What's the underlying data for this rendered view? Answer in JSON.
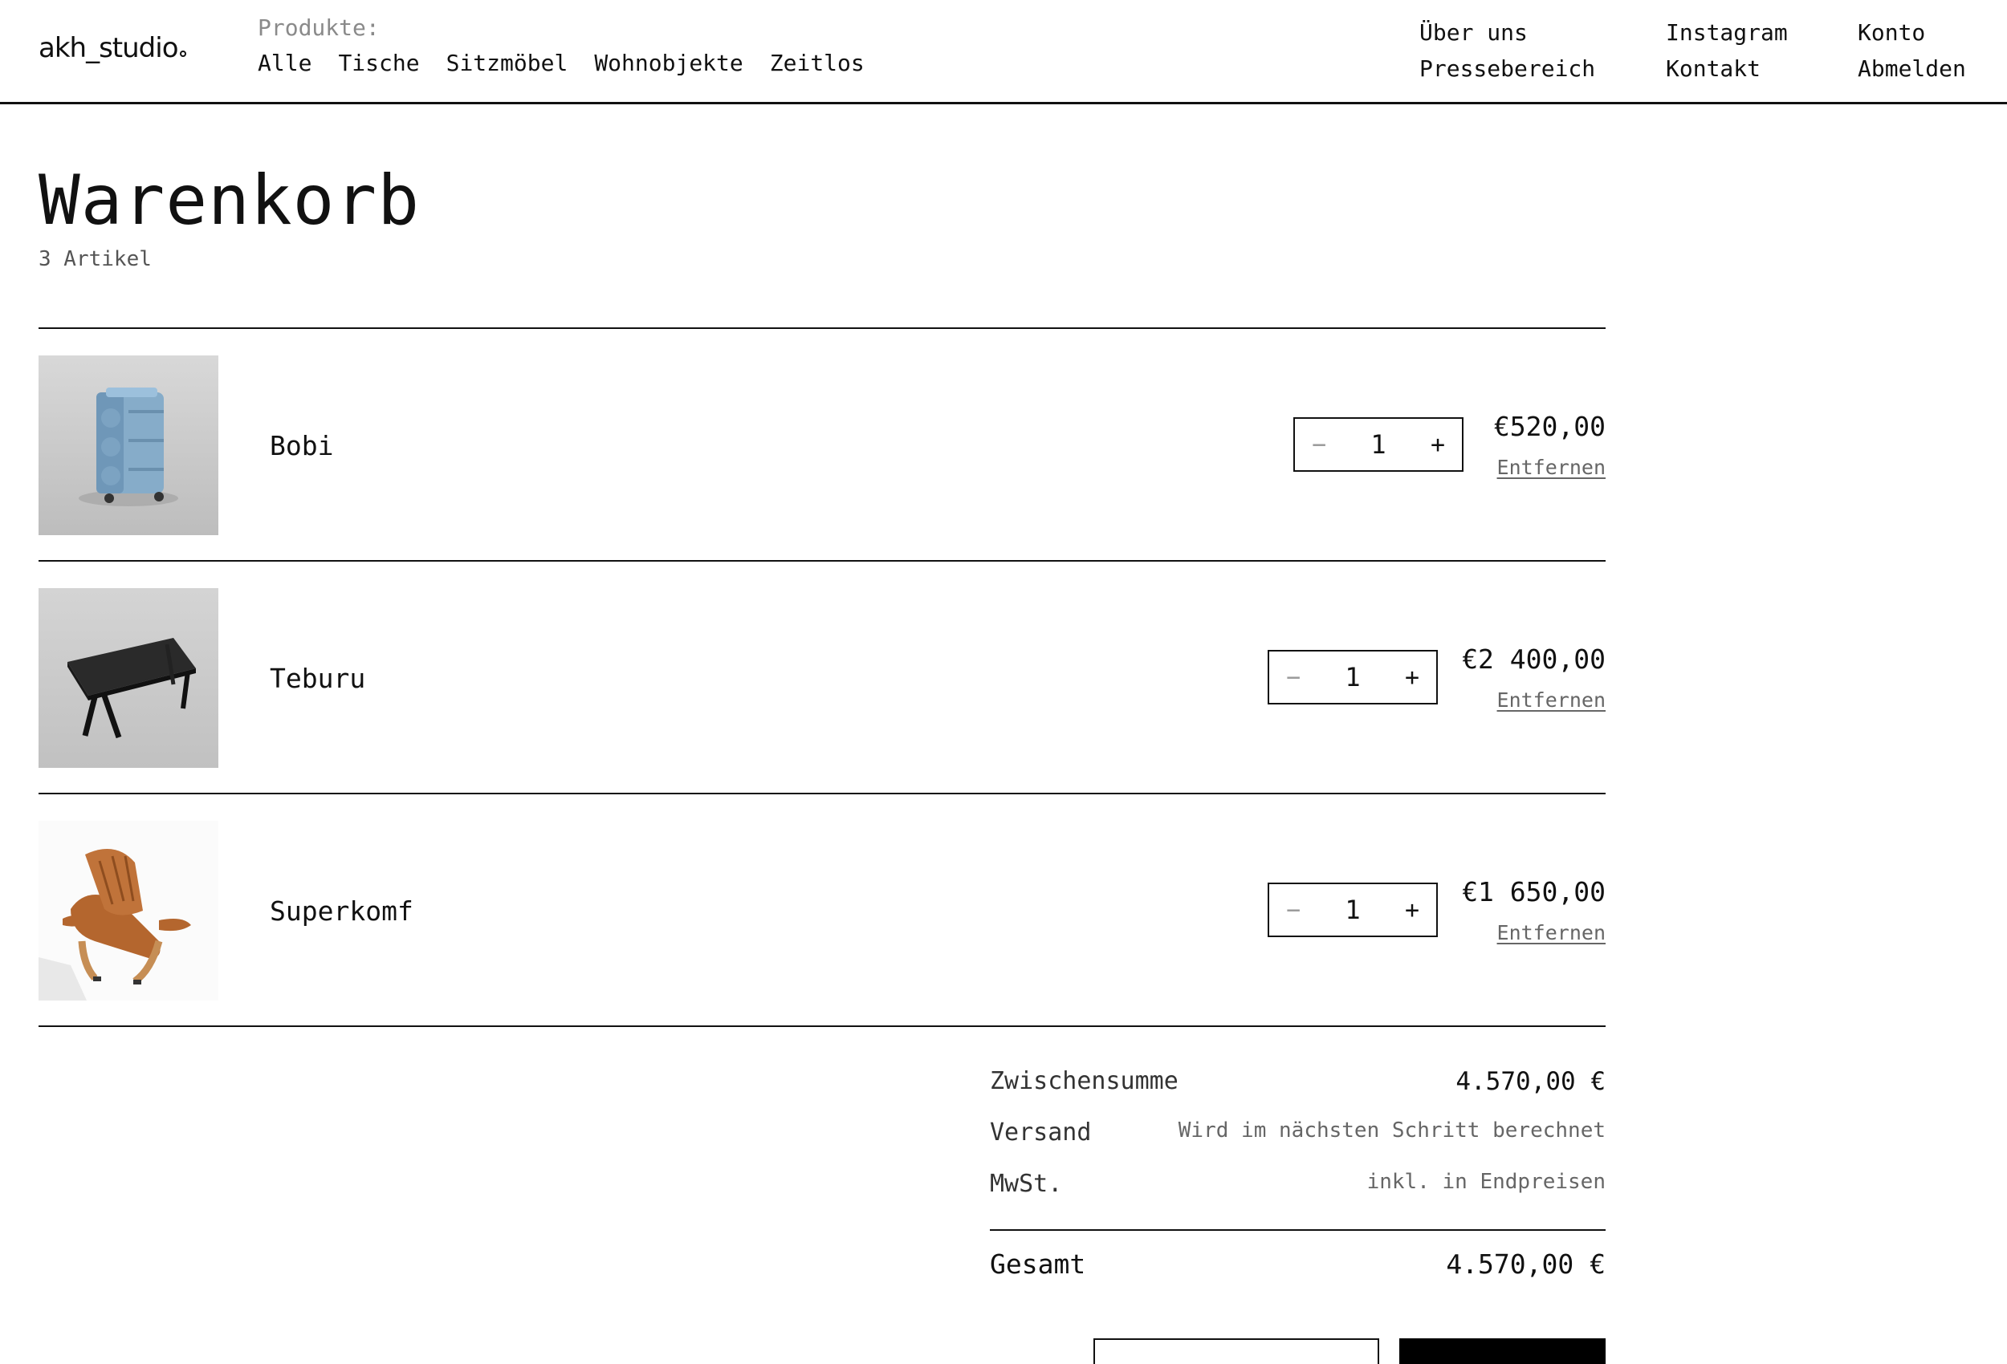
{
  "header": {
    "logo": "akh_studio",
    "products_label": "Produkte:",
    "categories": [
      "Alle",
      "Tische",
      "Sitzmöbel",
      "Wohnobjekte",
      "Zeitlos"
    ],
    "links_col1": [
      "Über uns",
      "Pressebereich"
    ],
    "links_col2": [
      "Instagram",
      "Kontakt"
    ],
    "links_col3": [
      "Konto",
      "Abmelden"
    ]
  },
  "cart": {
    "title": "Warenkorb",
    "count": "3 Artikel",
    "remove_label": "Entfernen",
    "items": [
      {
        "name": "Bobi",
        "qty": "1",
        "price": "€520,00",
        "image": "blue-trolley-cabinet"
      },
      {
        "name": "Teburu",
        "qty": "1",
        "price": "€2 400,00",
        "image": "black-table"
      },
      {
        "name": "Superkomf",
        "qty": "1",
        "price": "€1 650,00",
        "image": "leather-lounge-chair"
      }
    ],
    "qty_minus": "−",
    "qty_plus": "+"
  },
  "summary": {
    "subtotal_label": "Zwischensumme",
    "subtotal_value": "4.570,00 €",
    "shipping_label": "Versand",
    "shipping_value": "Wird im nächsten Schritt berechnet",
    "tax_label": "MwSt.",
    "tax_value": "inkl. in Endpreisen",
    "total_label": "Gesamt",
    "total_value": "4.570,00 €"
  },
  "colors": {
    "text": "#111111",
    "muted": "#8a8a8a",
    "accent_blue": "#8fb3d1",
    "accent_leather": "#b86a33"
  }
}
